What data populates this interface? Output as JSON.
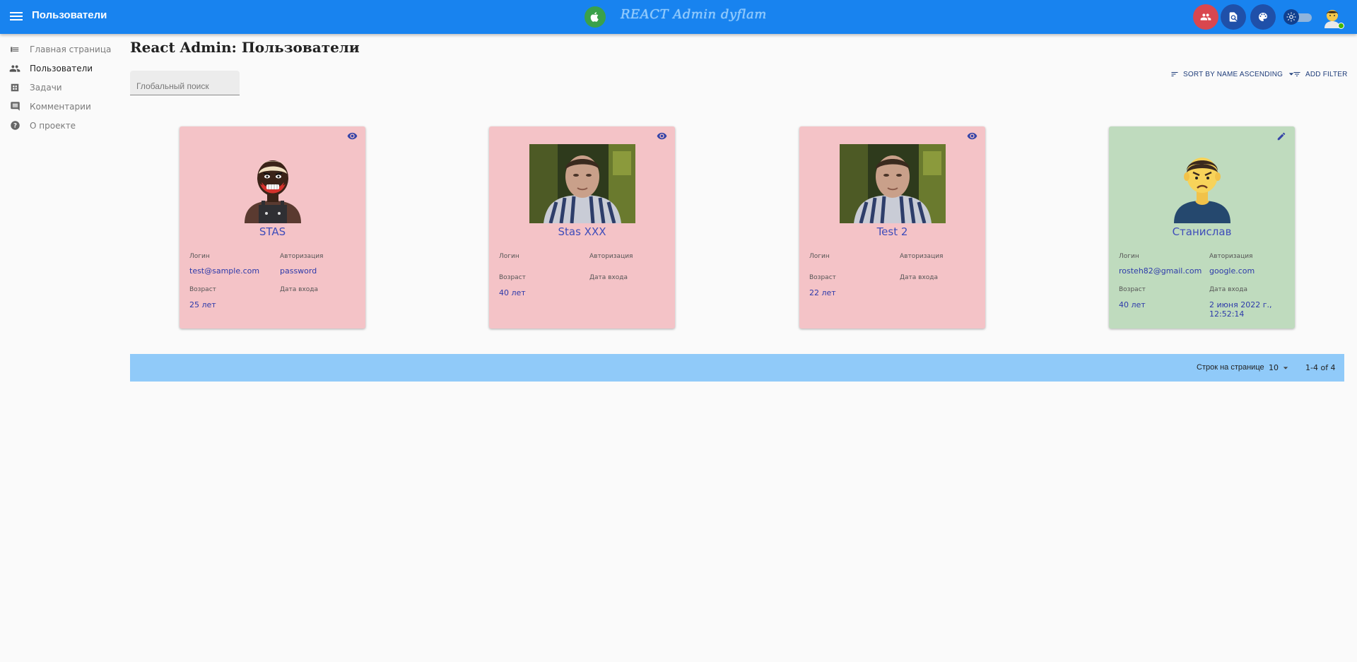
{
  "appbar": {
    "title": "Пользователи",
    "brand_text": "REACT Admin dyflam",
    "colors": {
      "bar": "#1883ef",
      "users_button": "#d9474f",
      "tool_buttons": "#1f50a9"
    }
  },
  "sidebar": {
    "items": [
      {
        "label": "Главная страница",
        "icon": "list-icon"
      },
      {
        "label": "Пользователи",
        "icon": "people-icon",
        "active": true
      },
      {
        "label": "Задачи",
        "icon": "tasks-icon"
      },
      {
        "label": "Комментарии",
        "icon": "comment-icon"
      },
      {
        "label": "О проекте",
        "icon": "help-icon"
      }
    ]
  },
  "main": {
    "title": "React Admin: Пользователи",
    "search_placeholder": "Глобальный поиск",
    "sort_label": "SORT BY NAME ASCENDING",
    "filter_label": "ADD FILTER"
  },
  "cards": [
    {
      "name": "STAS",
      "color": "#f4c3c7",
      "action": "eye-icon",
      "image": "cartoon-avatar",
      "login_label": "Логин",
      "login": "test@sample.com",
      "auth_label": "Авторизация",
      "auth": "password",
      "age_label": "Возраст",
      "age": "25 лет",
      "last_login_label": "Дата входа",
      "last_login": ""
    },
    {
      "name": "Stas XXX",
      "color": "#f4c3c7",
      "action": "eye-icon",
      "image": "photo",
      "login_label": "Логин",
      "login": "",
      "auth_label": "Авторизация",
      "auth": "",
      "age_label": "Возраст",
      "age": "40 лет",
      "last_login_label": "Дата входа",
      "last_login": ""
    },
    {
      "name": "Test 2",
      "color": "#f4c3c7",
      "action": "eye-icon",
      "image": "photo",
      "login_label": "Логин",
      "login": "",
      "auth_label": "Авторизация",
      "auth": "",
      "age_label": "Возраст",
      "age": "22 лет",
      "last_login_label": "Дата входа",
      "last_login": ""
    },
    {
      "name": "Станислав",
      "color": "#bfdbbe",
      "action": "edit-icon",
      "image": "cartoon-avatar",
      "login_label": "Логин",
      "login": "rosteh82@gmail.com",
      "auth_label": "Авторизация",
      "auth": "google.com",
      "age_label": "Возраст",
      "age": "40 лет",
      "last_login_label": "Дата входа",
      "last_login": "2 июня 2022 г., 12:52:14"
    }
  ],
  "pagination": {
    "rows_label": "Строк на странице",
    "rows_value": "10",
    "range": "1-4 of 4",
    "color": "#90caf9"
  }
}
